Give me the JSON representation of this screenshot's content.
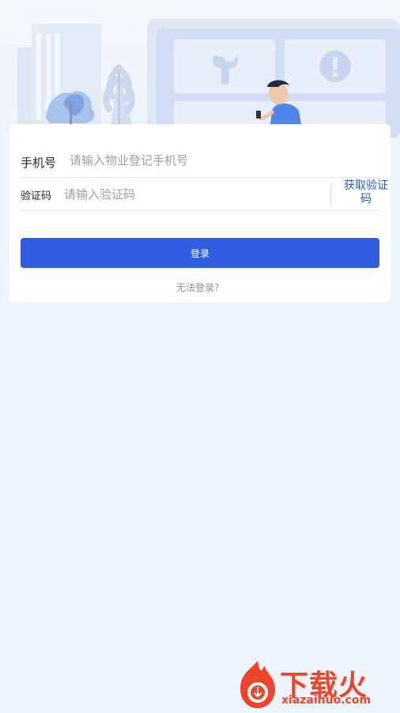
{
  "login": {
    "phone_label": "手机号",
    "phone_placeholder": "请输入物业登记手机号",
    "code_label": "验证码",
    "code_placeholder": "请输入验证码",
    "get_code_line1": "获取验证",
    "get_code_line2": "码",
    "submit_label": "登录",
    "cant_login_label": "无法登录？"
  },
  "watermark": {
    "text": "下载火",
    "url": "xiazaihuo.com"
  },
  "colors": {
    "accent": "#2f5ddf",
    "link": "#2e5bd9",
    "page_background": "#eef4fd",
    "watermark": "#ef4526"
  }
}
